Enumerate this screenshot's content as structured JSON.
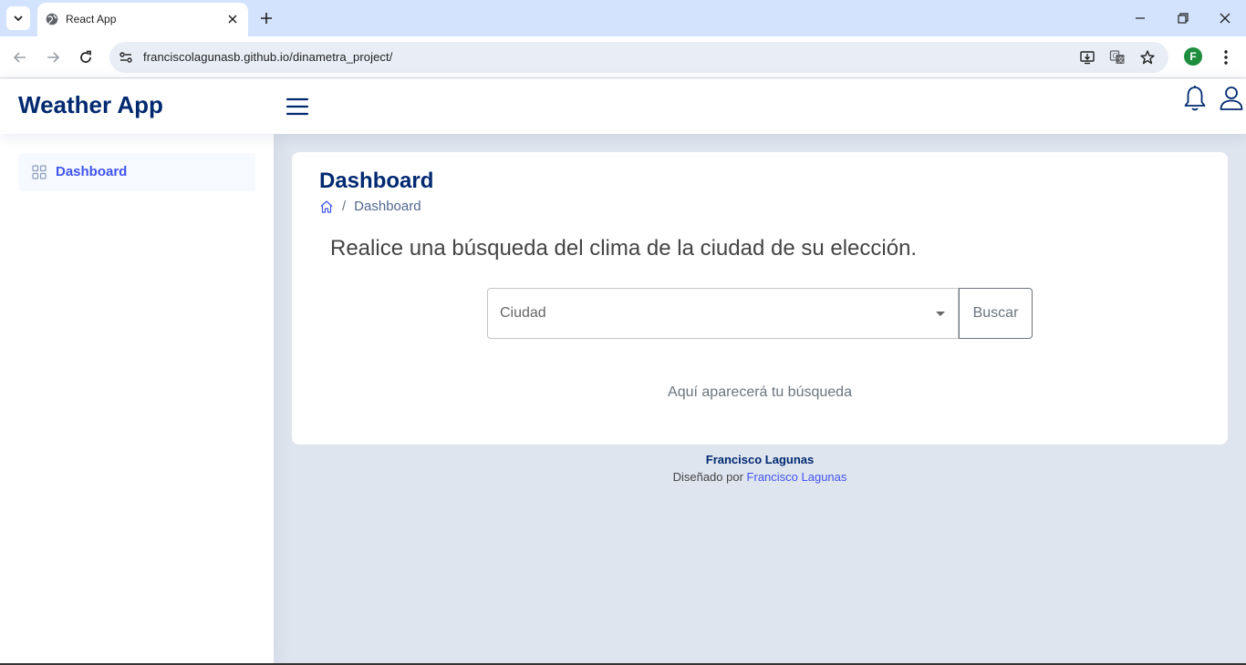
{
  "browser": {
    "tab_title": "React App",
    "url": "franciscolagunasb.github.io/dinametra_project/",
    "profile_initial": "F",
    "icons": [
      "tab-search-icon",
      "globe-icon",
      "close-icon",
      "plus-icon",
      "minimize-icon",
      "restore-icon",
      "back-icon",
      "forward-icon",
      "reload-icon",
      "site-info-icon",
      "install-app-icon",
      "translate-icon",
      "bookmark-star-icon",
      "more-vert-icon"
    ]
  },
  "header": {
    "brand": "Weather App"
  },
  "sidebar": {
    "items": [
      {
        "label": "Dashboard",
        "icon": "grid-icon",
        "active": true
      }
    ]
  },
  "main": {
    "title": "Dashboard",
    "breadcrumb": {
      "separator": "/",
      "current": "Dashboard"
    },
    "headline": "Realice una búsqueda del clima de la ciudad de su elección.",
    "search": {
      "select_label": "Ciudad",
      "button_label": "Buscar"
    },
    "result_placeholder": "Aquí aparecerá tu búsqueda"
  },
  "footer": {
    "name": "Francisco Lagunas",
    "credit_prefix": "Diseñado por",
    "credit_link": "Francisco Lagunas"
  },
  "colors": {
    "brand": "#012970",
    "accent": "#4154f1",
    "main_bg": "#dfe5ee",
    "tabbar_bg": "#d3e3fd"
  }
}
